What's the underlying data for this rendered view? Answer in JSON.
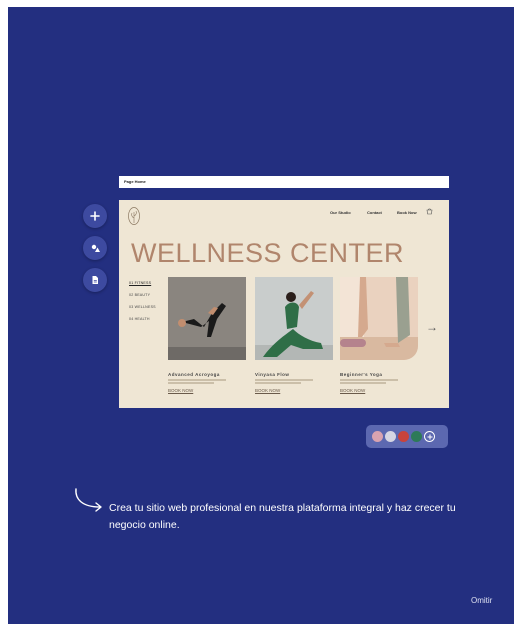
{
  "page_selector": {
    "label": "Page Home"
  },
  "side_tools": [
    {
      "name": "add-icon"
    },
    {
      "name": "theme-icon"
    },
    {
      "name": "page-icon"
    }
  ],
  "site": {
    "nav": [
      "Our Studio",
      "Contact",
      "Book Now"
    ],
    "hero_title": "WELLNESS CENTER",
    "categories": [
      "01 FITNESS",
      "02 BEAUTY",
      "03 WELLNESS",
      "04 HEALTH"
    ],
    "cards": [
      {
        "title": "Advanced Acroyoga",
        "button": "BOOK NOW"
      },
      {
        "title": "Vinyasa Flow",
        "button": "BOOK NOW"
      },
      {
        "title": "Beginner's Yoga",
        "button": "BOOK NOW"
      }
    ]
  },
  "palette": {
    "colors": [
      "#d9a3b0",
      "#d6d6e3",
      "#c8433c",
      "#2d7a59",
      "#3a3f85"
    ]
  },
  "caption": "Crea tu sitio web profesional en nuestra plataforma integral y haz crecer tu negocio online.",
  "skip_label": "Omitir"
}
